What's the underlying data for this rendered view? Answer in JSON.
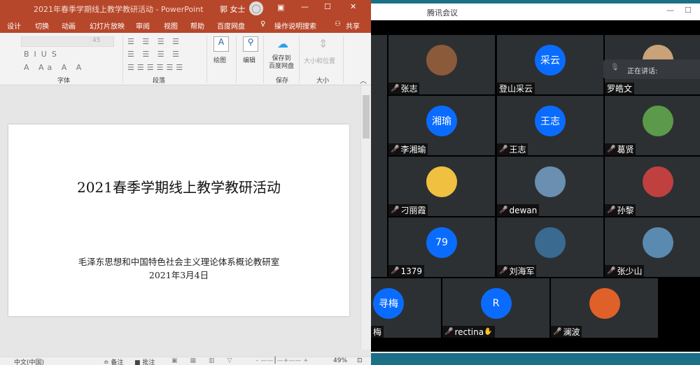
{
  "ppt": {
    "window_title": "2021年春季学期线上教学教研活动 - PowerPoint",
    "user": "郭 女士",
    "menu": [
      "设计",
      "切换",
      "动画",
      "幻灯片放映",
      "审阅",
      "视图",
      "帮助",
      "百度网盘"
    ],
    "tell_me": "操作说明搜索",
    "share": "共享",
    "font_size": "45",
    "groups": {
      "font": "字体",
      "paragraph": "段落",
      "save": "保存",
      "size": "大小"
    },
    "buttons": {
      "draw": "绘图",
      "edit": "编辑",
      "save_baidu": "保存到\n百度网盘",
      "size_position": "大小和位置"
    },
    "slide": {
      "title": "2021春季学期线上教学教研活动",
      "subtitle": "毛泽东思想和中国特色社会主义理论体系概论教研室",
      "date": "2021年3月4日"
    },
    "status": {
      "language": "中文(中国)",
      "notes": "备注",
      "comments": "批注",
      "zoom": "49%"
    }
  },
  "meeting": {
    "title": "腾讯会议",
    "speaking_label": "正在讲话:",
    "accent": "#0a6cff",
    "rows": [
      [
        {
          "name": "张志",
          "avatar": "photo",
          "muted": true
        },
        {
          "name": "登山采云",
          "avatar": "采云",
          "muted": false
        },
        {
          "name": "罗皓文",
          "avatar": "photo",
          "muted": false
        }
      ],
      [
        {
          "name": "李湘瑜",
          "avatar": "湘瑜",
          "muted": true
        },
        {
          "name": "王志",
          "avatar": "王志",
          "muted": true
        },
        {
          "name": "葛贤",
          "avatar": "photo",
          "muted": true
        }
      ],
      [
        {
          "name": "刁丽霞",
          "avatar": "photo",
          "muted": true
        },
        {
          "name": "dewan",
          "avatar": "photo",
          "muted": true
        },
        {
          "name": "孙黎",
          "avatar": "photo",
          "muted": true
        }
      ],
      [
        {
          "name": "1379",
          "avatar": "79",
          "muted": true
        },
        {
          "name": "刘海军",
          "avatar": "photo",
          "muted": true
        },
        {
          "name": "张少山",
          "avatar": "photo",
          "muted": true
        }
      ]
    ],
    "bottom": [
      {
        "name": "梅",
        "avatar": "寻梅",
        "muted": false
      },
      {
        "name": "rectina",
        "avatar": "R",
        "muted": true,
        "hand": true
      },
      {
        "name": "澜波",
        "avatar": "photo",
        "muted": true
      }
    ]
  }
}
